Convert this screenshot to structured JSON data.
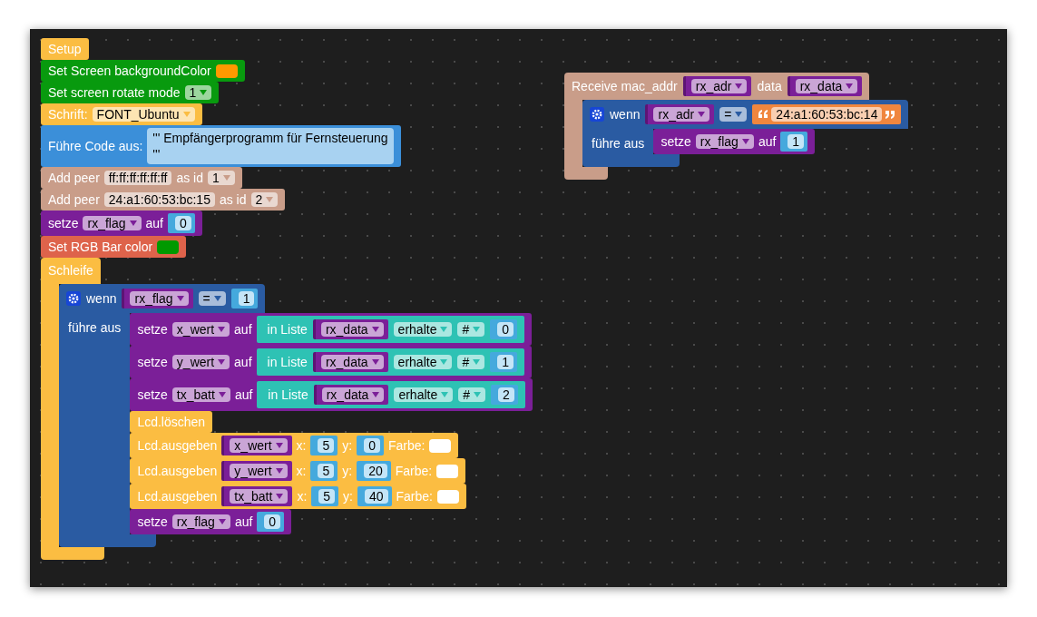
{
  "workspace": {
    "stacks": [
      {
        "blocks": [
          {
            "kind": "stmt",
            "color": "#fbbd42",
            "parts": [
              {
                "kind": "label",
                "text": "Setup"
              }
            ]
          },
          {
            "kind": "stmt",
            "color": "#089a0e",
            "parts": [
              {
                "kind": "label",
                "text": "Set Screen backgroundColor"
              },
              {
                "kind": "swatch",
                "color": "#ff9900"
              }
            ]
          },
          {
            "kind": "stmt",
            "color": "#089a0e",
            "parts": [
              {
                "kind": "label",
                "text": "Set screen rotate mode"
              },
              {
                "kind": "dropdown",
                "text": "1"
              }
            ]
          },
          {
            "kind": "stmt",
            "color": "#fbbd42",
            "parts": [
              {
                "kind": "label",
                "text": "Schrift:"
              },
              {
                "kind": "dropdown",
                "text": "FONT_Ubuntu"
              }
            ]
          },
          {
            "kind": "stmt",
            "color": "#3b8fd9",
            "parts": [
              {
                "kind": "label",
                "text": "Führe Code aus:"
              },
              {
                "kind": "textarea",
                "text": "''' Empfängerprogramm für Fernsteuerung\n'''"
              }
            ]
          },
          {
            "kind": "stmt",
            "color": "#c99d89",
            "parts": [
              {
                "kind": "label",
                "text": "Add peer"
              },
              {
                "kind": "field",
                "text": "ff:ff:ff:ff:ff:ff"
              },
              {
                "kind": "label",
                "text": "as id"
              },
              {
                "kind": "dropdown",
                "text": "1"
              }
            ]
          },
          {
            "kind": "stmt",
            "color": "#c99d89",
            "parts": [
              {
                "kind": "label",
                "text": "Add peer"
              },
              {
                "kind": "field",
                "text": "24:a1:60:53:bc:15"
              },
              {
                "kind": "label",
                "text": "as id"
              },
              {
                "kind": "dropdown",
                "text": "2"
              }
            ]
          },
          {
            "kind": "stmt",
            "color": "#7b1f98",
            "parts": [
              {
                "kind": "label",
                "text": "setze"
              },
              {
                "kind": "dropdown",
                "text": "rx_flag"
              },
              {
                "kind": "label",
                "text": "auf"
              },
              {
                "kind": "num",
                "text": "0"
              }
            ]
          },
          {
            "kind": "stmt",
            "color": "#de634b",
            "parts": [
              {
                "kind": "label",
                "text": "Set RGB Bar color"
              },
              {
                "kind": "swatch",
                "color": "#009900"
              }
            ]
          },
          {
            "kind": "loop",
            "color": "#fbbd42",
            "parts": [
              {
                "kind": "label",
                "text": "Schleife"
              }
            ],
            "children": [
              {
                "kind": "if",
                "color": "#2a5ba2",
                "parts": [
                  {
                    "kind": "label",
                    "text": "wenn"
                  },
                  {
                    "kind": "var",
                    "text": "rx_flag"
                  },
                  {
                    "kind": "dropdown",
                    "text": "="
                  },
                  {
                    "kind": "num",
                    "text": "1"
                  }
                ],
                "body_label": "führe aus",
                "children": [
                  {
                    "kind": "stmt",
                    "color": "#7b1f98",
                    "parts": [
                      {
                        "kind": "label",
                        "text": "setze"
                      },
                      {
                        "kind": "dropdown",
                        "text": "x_wert"
                      },
                      {
                        "kind": "label",
                        "text": "auf"
                      },
                      {
                        "kind": "list",
                        "color": "#2ec2b4",
                        "parts": [
                          {
                            "kind": "label",
                            "text": "in Liste"
                          },
                          {
                            "kind": "var",
                            "text": "rx_data"
                          },
                          {
                            "kind": "dropdown",
                            "text": "erhalte"
                          },
                          {
                            "kind": "dropdown",
                            "text": "#"
                          },
                          {
                            "kind": "num",
                            "text": "0"
                          }
                        ]
                      }
                    ]
                  },
                  {
                    "kind": "stmt",
                    "color": "#7b1f98",
                    "parts": [
                      {
                        "kind": "label",
                        "text": "setze"
                      },
                      {
                        "kind": "dropdown",
                        "text": "y_wert"
                      },
                      {
                        "kind": "label",
                        "text": "auf"
                      },
                      {
                        "kind": "list",
                        "color": "#2ec2b4",
                        "parts": [
                          {
                            "kind": "label",
                            "text": "in Liste"
                          },
                          {
                            "kind": "var",
                            "text": "rx_data"
                          },
                          {
                            "kind": "dropdown",
                            "text": "erhalte"
                          },
                          {
                            "kind": "dropdown",
                            "text": "#"
                          },
                          {
                            "kind": "num",
                            "text": "1"
                          }
                        ]
                      }
                    ]
                  },
                  {
                    "kind": "stmt",
                    "color": "#7b1f98",
                    "parts": [
                      {
                        "kind": "label",
                        "text": "setze"
                      },
                      {
                        "kind": "dropdown",
                        "text": "tx_batt"
                      },
                      {
                        "kind": "label",
                        "text": "auf"
                      },
                      {
                        "kind": "list",
                        "color": "#2ec2b4",
                        "parts": [
                          {
                            "kind": "label",
                            "text": "in Liste"
                          },
                          {
                            "kind": "var",
                            "text": "rx_data"
                          },
                          {
                            "kind": "dropdown",
                            "text": "erhalte"
                          },
                          {
                            "kind": "dropdown",
                            "text": "#"
                          },
                          {
                            "kind": "num",
                            "text": "2"
                          }
                        ]
                      }
                    ]
                  },
                  {
                    "kind": "stmt",
                    "color": "#fbbd42",
                    "parts": [
                      {
                        "kind": "label",
                        "text": "Lcd.löschen"
                      }
                    ]
                  },
                  {
                    "kind": "stmt",
                    "color": "#fbbd42",
                    "parts": [
                      {
                        "kind": "label",
                        "text": "Lcd.ausgeben"
                      },
                      {
                        "kind": "var",
                        "text": "x_wert"
                      },
                      {
                        "kind": "label",
                        "text": "x:"
                      },
                      {
                        "kind": "num",
                        "text": "5"
                      },
                      {
                        "kind": "label",
                        "text": "y:"
                      },
                      {
                        "kind": "num",
                        "text": "0"
                      },
                      {
                        "kind": "label",
                        "text": "Farbe:"
                      },
                      {
                        "kind": "swatch",
                        "color": "#ffffff"
                      }
                    ]
                  },
                  {
                    "kind": "stmt",
                    "color": "#fbbd42",
                    "parts": [
                      {
                        "kind": "label",
                        "text": "Lcd.ausgeben"
                      },
                      {
                        "kind": "var",
                        "text": "y_wert"
                      },
                      {
                        "kind": "label",
                        "text": "x:"
                      },
                      {
                        "kind": "num",
                        "text": "5"
                      },
                      {
                        "kind": "label",
                        "text": "y:"
                      },
                      {
                        "kind": "num",
                        "text": "20"
                      },
                      {
                        "kind": "label",
                        "text": "Farbe:"
                      },
                      {
                        "kind": "swatch",
                        "color": "#ffffff"
                      }
                    ]
                  },
                  {
                    "kind": "stmt",
                    "color": "#fbbd42",
                    "parts": [
                      {
                        "kind": "label",
                        "text": "Lcd.ausgeben"
                      },
                      {
                        "kind": "var",
                        "text": "tx_batt"
                      },
                      {
                        "kind": "label",
                        "text": "x:"
                      },
                      {
                        "kind": "num",
                        "text": "5"
                      },
                      {
                        "kind": "label",
                        "text": "y:"
                      },
                      {
                        "kind": "num",
                        "text": "40"
                      },
                      {
                        "kind": "label",
                        "text": "Farbe:"
                      },
                      {
                        "kind": "swatch",
                        "color": "#ffffff"
                      }
                    ]
                  },
                  {
                    "kind": "stmt",
                    "color": "#7b1f98",
                    "parts": [
                      {
                        "kind": "label",
                        "text": "setze"
                      },
                      {
                        "kind": "dropdown",
                        "text": "rx_flag"
                      },
                      {
                        "kind": "label",
                        "text": "auf"
                      },
                      {
                        "kind": "num",
                        "text": "0"
                      }
                    ]
                  }
                ]
              }
            ]
          }
        ]
      },
      {
        "blocks": [
          {
            "kind": "hat",
            "color": "#c99d89",
            "parts": [
              {
                "kind": "label",
                "text": "Receive mac_addr"
              },
              {
                "kind": "var",
                "text": "rx_adr"
              },
              {
                "kind": "label",
                "text": "data"
              },
              {
                "kind": "var",
                "text": "rx_data"
              }
            ],
            "children": [
              {
                "kind": "if",
                "color": "#2a5ba2",
                "parts": [
                  {
                    "kind": "label",
                    "text": "wenn"
                  },
                  {
                    "kind": "var",
                    "text": "rx_adr"
                  },
                  {
                    "kind": "dropdown",
                    "text": "="
                  },
                  {
                    "kind": "str",
                    "text": "24:a1:60:53:bc:14"
                  }
                ],
                "body_label": "führe aus",
                "children": [
                  {
                    "kind": "stmt",
                    "color": "#7b1f98",
                    "parts": [
                      {
                        "kind": "label",
                        "text": "setze"
                      },
                      {
                        "kind": "dropdown",
                        "text": "rx_flag"
                      },
                      {
                        "kind": "label",
                        "text": "auf"
                      },
                      {
                        "kind": "num",
                        "text": "1"
                      }
                    ]
                  }
                ]
              }
            ]
          }
        ]
      }
    ]
  }
}
